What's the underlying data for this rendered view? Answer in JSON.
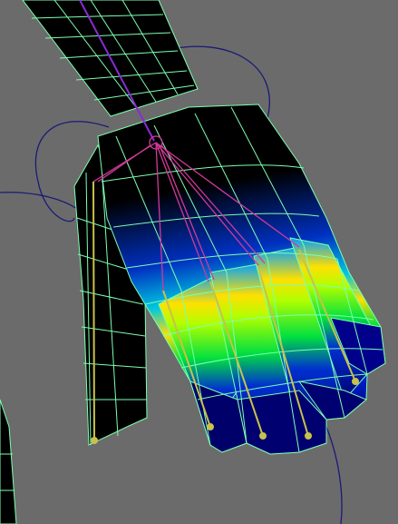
{
  "viewport": {
    "colors": {
      "background": "#6b6b6b",
      "wireframe": "#7dffb0",
      "curve": "#1a1a78",
      "bone_arm": "#8a2bd6",
      "bone_finger": "#d23a9a",
      "bone_thumb": "#c8c24a",
      "weight_low": "#00009a",
      "weight_mid": "#00e040",
      "weight_high": "#ffe000"
    },
    "paint_mode": "skin-weight-heatmap"
  }
}
